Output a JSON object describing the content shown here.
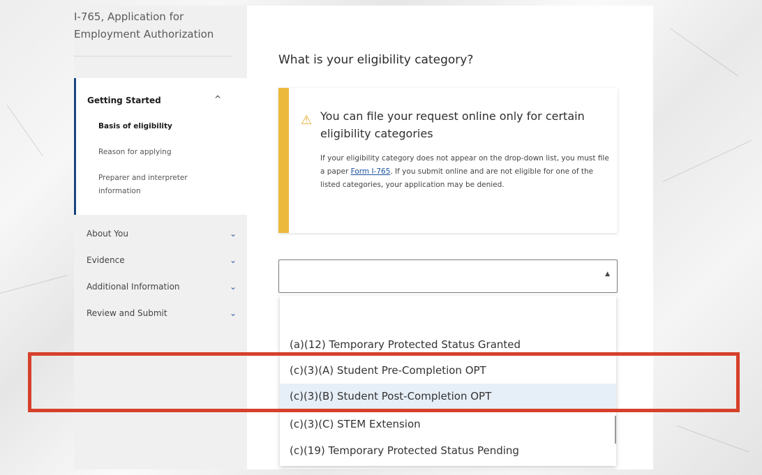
{
  "app": {
    "title": "I-765, Application for Employment Authorization"
  },
  "sidebar": {
    "open_section": {
      "title": "Getting Started",
      "items": [
        {
          "label": "Basis of eligibility",
          "active": true
        },
        {
          "label": "Reason for applying",
          "active": false
        },
        {
          "label": "Preparer and interpreter information",
          "active": false
        }
      ]
    },
    "sections": [
      {
        "label": "About You"
      },
      {
        "label": "Evidence"
      },
      {
        "label": "Additional Information"
      },
      {
        "label": "Review and Submit"
      }
    ]
  },
  "main": {
    "question": "What is your eligibility category?",
    "alert": {
      "title": "You can file your request online only for certain eligibility categories",
      "body_before_link": "If your eligibility category does not appear on the drop-down list, you must file a paper ",
      "link_text": "Form I-765",
      "body_after_link": ". If you submit online and are not eligible for one of the listed categories, your application may be denied."
    },
    "select": {
      "value": "",
      "options": [
        {
          "label": "(a)(12) Temporary Protected Status Granted",
          "highlighted": false
        },
        {
          "label": "(c)(3)(A) Student Pre-Completion OPT",
          "highlighted": false
        },
        {
          "label": "(c)(3)(B) Student Post-Completion OPT",
          "highlighted": true
        },
        {
          "label": "(c)(3)(C) STEM Extension",
          "highlighted": false
        },
        {
          "label": "(c)(19) Temporary Protected Status Pending",
          "highlighted": false
        }
      ]
    }
  },
  "icons": {
    "warning": "warning-triangle-icon",
    "expand": "chevron-down-icon",
    "collapse": "chevron-up-icon",
    "dropdown": "caret-up-icon"
  },
  "colors": {
    "alert_accent": "#ecb93c",
    "nav_accent": "#1a4480",
    "option_highlight": "#e6eef7",
    "annotation_box": "#d6402a"
  }
}
